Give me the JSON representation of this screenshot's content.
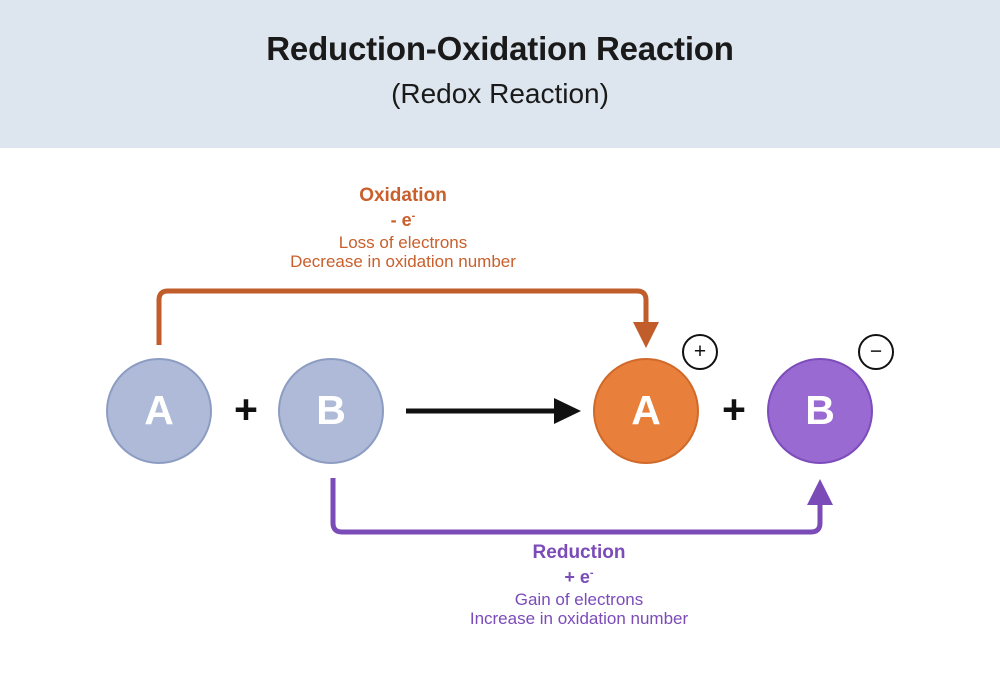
{
  "header": {
    "title": "Reduction-Oxidation Reaction",
    "subtitle": "(Redox Reaction)",
    "background_color": "#dde6ee"
  },
  "colors": {
    "oxidation": "#c85f2c",
    "oxidation_circle": "#e87f3b",
    "reduction": "#7b4bb8",
    "reduction_circle": "#9a6ad3",
    "reactant_circle": "#aebad7",
    "arrow": "#111111",
    "text": "#1a1a1a"
  },
  "equation": {
    "reactants": [
      {
        "label": "A",
        "name": "reactant-a"
      },
      {
        "label": "B",
        "name": "reactant-b"
      }
    ],
    "products": [
      {
        "label": "A",
        "name": "product-a",
        "charge": "+"
      },
      {
        "label": "B",
        "name": "product-b",
        "charge": "−"
      }
    ],
    "plus_operator": "+",
    "reaction_arrow": "→"
  },
  "annotations": {
    "oxidation": {
      "title": "Oxidation",
      "electron": "- e",
      "electron_superscript": "-",
      "line1": "Loss of electrons",
      "line2": "Decrease in oxidation number"
    },
    "reduction": {
      "title": "Reduction",
      "electron": "+ e",
      "electron_superscript": "-",
      "line1": "Gain of electrons",
      "line2": "Increase in oxidation number"
    }
  },
  "charges": {
    "positive": "+",
    "negative": "−"
  }
}
